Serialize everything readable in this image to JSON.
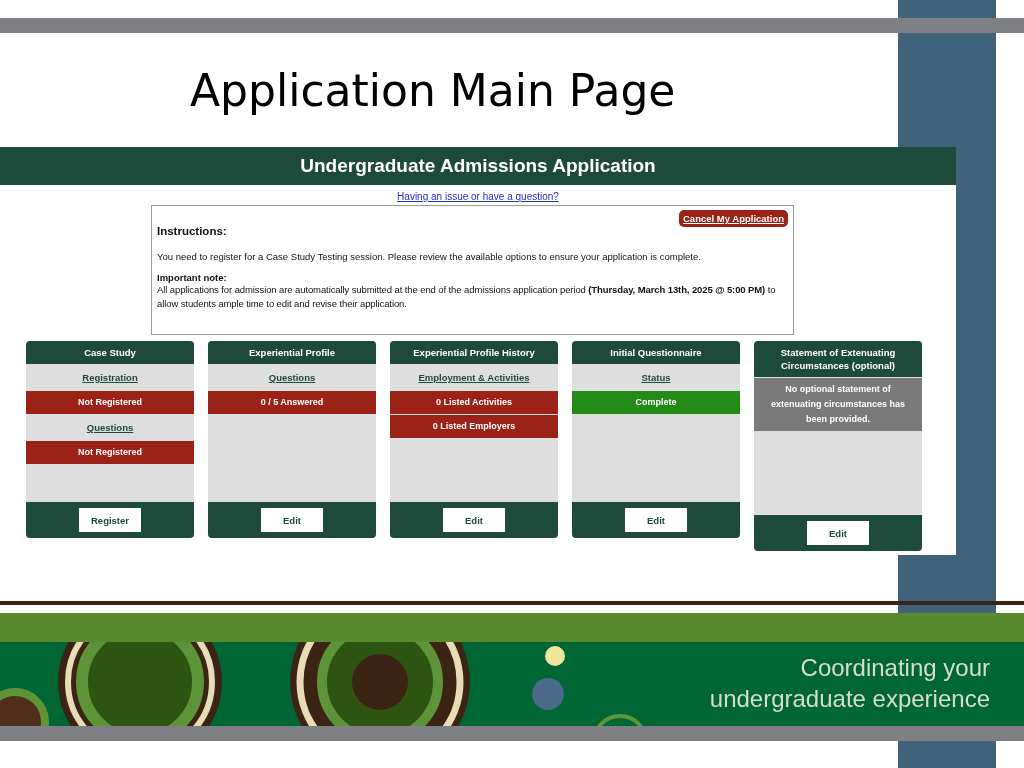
{
  "slide": {
    "title": "Application Main Page",
    "tagline": [
      "Coordinating your",
      "undergraduate experience"
    ]
  },
  "app": {
    "header": "Undergraduate Admissions Application",
    "help_link": "Having an issue or have a question?",
    "cancel_button": "Cancel My Application",
    "instructions": {
      "heading": "Instructions:",
      "text": "You need to register for a Case Study Testing session. Please review the available options to ensure your application is complete.",
      "note_heading": "Important note:",
      "note": "All applications for admission are automatically submitted at the end of the admissions application period **(Thursday, March 13th, 2025 @ 5:00 PM)** to allow students ample time to edit and revise their application."
    },
    "cards": [
      {
        "title": "Case Study",
        "items": [
          {
            "kind": "link",
            "text": "Registration"
          },
          {
            "kind": "status",
            "text": "Not Registered",
            "color": "#9b2217"
          },
          {
            "kind": "link",
            "text": "Questions"
          },
          {
            "kind": "status",
            "text": "Not Registered",
            "color": "#9b2217"
          }
        ],
        "button": "Register"
      },
      {
        "title": "Experiential Profile",
        "items": [
          {
            "kind": "link",
            "text": "Questions"
          },
          {
            "kind": "status",
            "text": "0 / 5 Answered",
            "color": "#9b2217"
          }
        ],
        "button": "Edit"
      },
      {
        "title": "Experiential Profile History",
        "items": [
          {
            "kind": "link",
            "text": "Employment & Activities"
          },
          {
            "kind": "status",
            "text": "0 Listed Activities",
            "color": "#9b2217"
          },
          {
            "kind": "status",
            "text": "0 Listed Employers",
            "color": "#9b2217"
          }
        ],
        "button": "Edit"
      },
      {
        "title": "Initial Questionnaire",
        "items": [
          {
            "kind": "link",
            "text": "Status"
          },
          {
            "kind": "status",
            "text": "Complete",
            "color": "#238a17"
          }
        ],
        "button": "Edit"
      },
      {
        "title": "Statement of Extenuating Circumstances (optional)",
        "items": [
          {
            "kind": "status",
            "text": "No optional statement of extenuating circumstances has been provided.",
            "color": "#7a7a7a"
          }
        ],
        "button": "Edit"
      }
    ]
  }
}
